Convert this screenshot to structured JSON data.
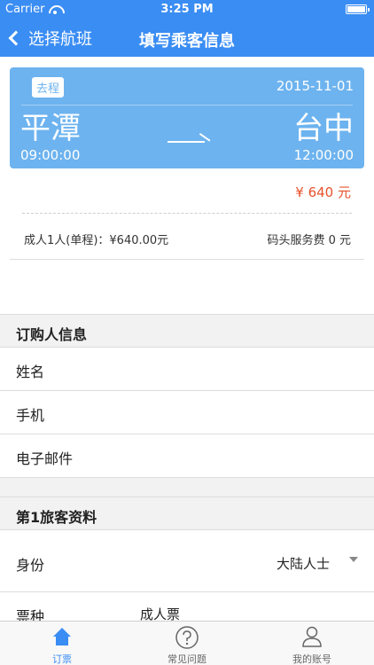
{
  "status_bar": {
    "carrier": "Carrier",
    "time": "3:25 PM"
  },
  "nav": {
    "back_label": "选择航班",
    "title": "填写乘客信息"
  },
  "trip": {
    "tag": "去程",
    "date": "2015-11-01",
    "from_city": "平潭",
    "from_time": "09:00:00",
    "to_city": "台中",
    "to_time": "12:00:00",
    "price": "¥ 640 元",
    "fare_detail": "成人1人(单程)：¥640.00元",
    "service_fee": "码头服务费 0 元"
  },
  "buyer_section": {
    "title": "订购人信息",
    "fields": {
      "name": "姓名",
      "phone": "手机",
      "email": "电子邮件"
    }
  },
  "passenger_section": {
    "title": "第1旅客资料",
    "identity_label": "身份",
    "identity_value": "大陆人士",
    "ticket_type_label": "票种",
    "ticket_type_value": "成人票"
  },
  "tabbar": {
    "tabs": [
      {
        "label": "订票",
        "icon": "home-icon",
        "active": true
      },
      {
        "label": "常见问题",
        "icon": "question-icon",
        "active": false
      },
      {
        "label": "我的账号",
        "icon": "user-icon",
        "active": false
      }
    ]
  },
  "colors": {
    "accent": "#3a8df3",
    "ticket": "#6db3ef",
    "price": "#e7522b"
  }
}
